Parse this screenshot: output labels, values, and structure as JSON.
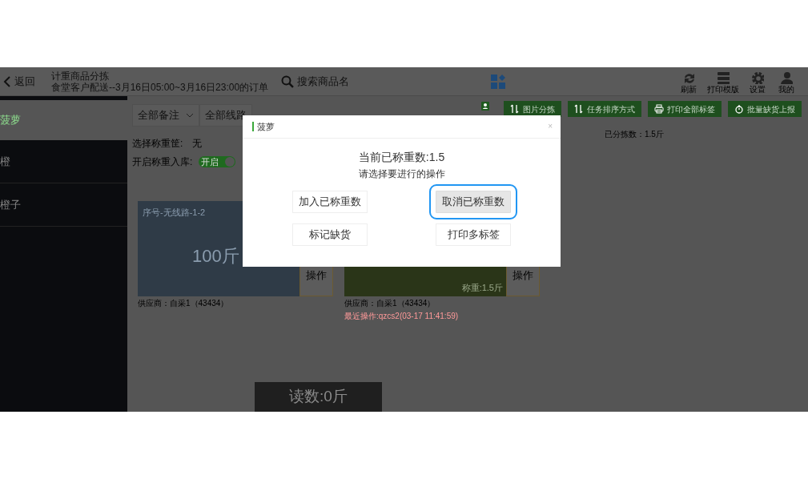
{
  "header": {
    "back": "返回",
    "title": "计重商品分拣",
    "subtitle": "食堂客户配送--3月16日05:00~3月16日23:00的订单",
    "search": {
      "placeholder": "搜索商品名"
    },
    "tools": [
      {
        "kind": "refresh",
        "label": "刷新"
      },
      {
        "kind": "stack",
        "label": "打印模版"
      },
      {
        "kind": "gear",
        "label": "设置"
      },
      {
        "kind": "user",
        "label": "我的"
      }
    ]
  },
  "sidebar": {
    "items": [
      {
        "label": "菠萝",
        "selected": true
      },
      {
        "label": "橙",
        "selected": false
      },
      {
        "label": "橙子",
        "selected": false
      }
    ]
  },
  "filters": [
    "全部备注",
    "全部线路"
  ],
  "actions": [
    {
      "kind": "sort",
      "label": "图片分拣"
    },
    {
      "kind": "sort",
      "label": "任务排序方式"
    },
    {
      "kind": "print",
      "label": "打印全部标签"
    },
    {
      "kind": "report",
      "label": "批量缺货上报"
    }
  ],
  "sorted_count": "已分拣数：1.5斤",
  "basket": {
    "label": "选择称重筐:",
    "value": "无"
  },
  "stock_in": {
    "label": "开启称重入库:",
    "toggle_text": "开启",
    "on": true
  },
  "cards": [
    {
      "title": "序号-无线路-1-2",
      "weight": "100斤",
      "color": "#2f3b47",
      "action": "操作",
      "supplier": "供应商：自采1（43434）"
    },
    {
      "weighed": "称重:1.5斤",
      "color": "#2a3518",
      "action": "操作",
      "supplier": "供应商：自采1（43434）",
      "last_op": "最近操作:qzcs2(03-17 11:41:59)"
    }
  ],
  "reading": "读数:0斤",
  "dialog": {
    "title": "菠萝",
    "close": "×",
    "current": "当前已称重数:1.5",
    "prompt": "请选择要进行的操作",
    "buttons": [
      {
        "label": "加入已称重数",
        "focused": false
      },
      {
        "label": "取消已称重数",
        "focused": true
      },
      {
        "label": "标记缺货",
        "focused": false
      },
      {
        "label": "打印多标签",
        "focused": false
      }
    ]
  }
}
